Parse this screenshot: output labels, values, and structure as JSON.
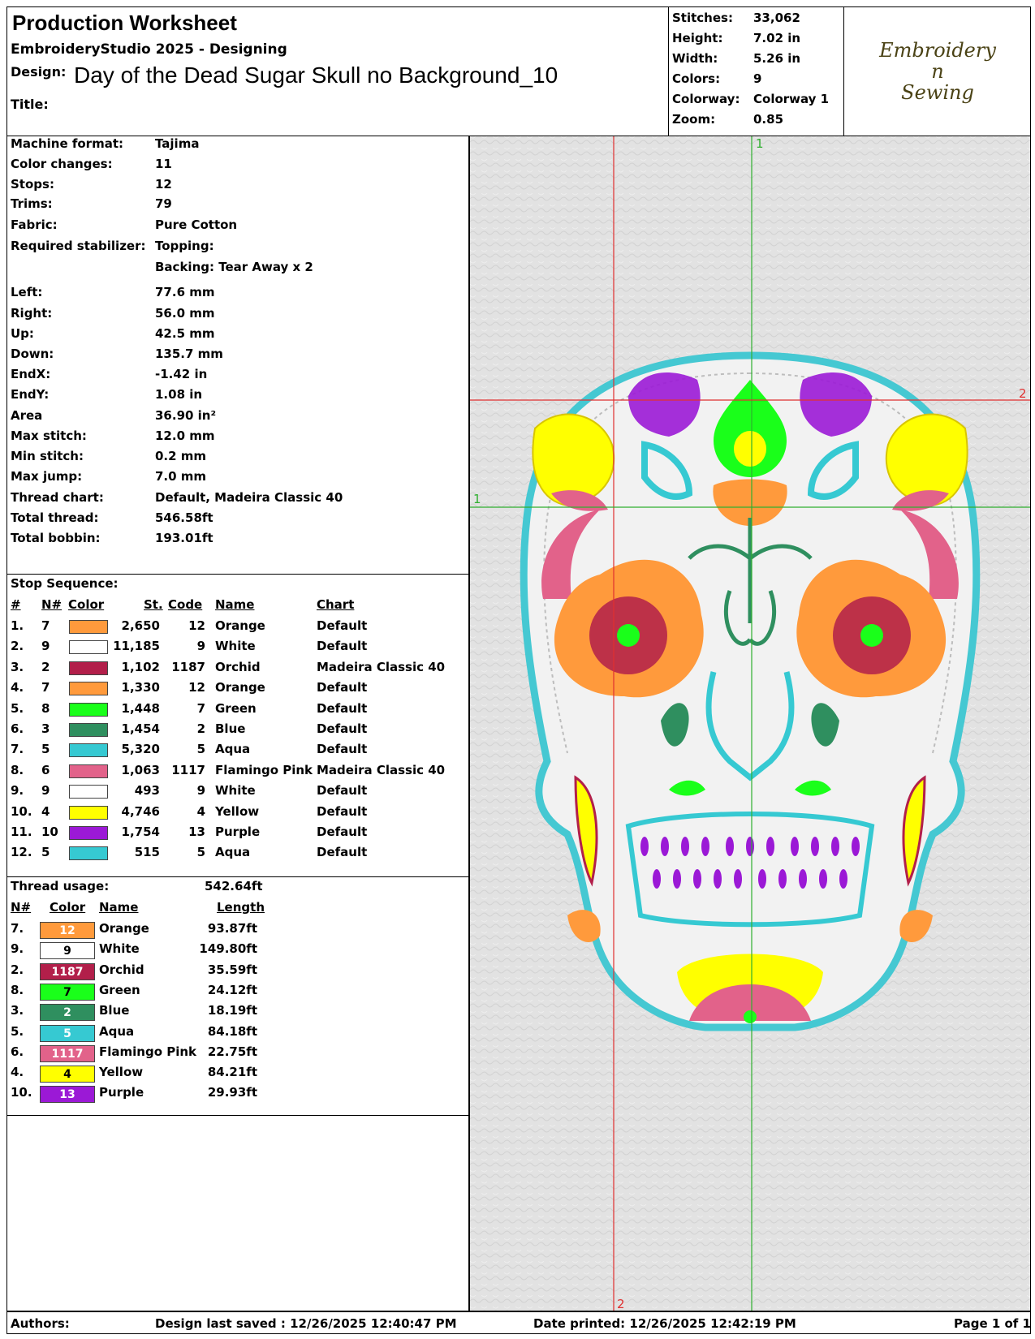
{
  "header": {
    "sheet_title": "Production Worksheet",
    "software": "EmbroideryStudio 2025 - Designing",
    "design_label": "Design:",
    "design_name": "Day of the Dead Sugar Skull no Background_10",
    "title_label": "Title:",
    "stats": [
      {
        "label": "Stitches:",
        "value": "33,062"
      },
      {
        "label": "Height:",
        "value": "7.02 in"
      },
      {
        "label": "Width:",
        "value": "5.26 in"
      },
      {
        "label": "Colors:",
        "value": "9"
      },
      {
        "label": "Colorway:",
        "value": "Colorway 1"
      },
      {
        "label": "Zoom:",
        "value": "0.85"
      }
    ],
    "logo_line1": "Embroidery",
    "logo_line2": "n",
    "logo_line3": "Sewing"
  },
  "info": [
    {
      "label": "Machine format:",
      "value": "Tajima"
    },
    {
      "label": "Color changes:",
      "value": "11"
    },
    {
      "label": "Stops:",
      "value": "12"
    },
    {
      "label": "Trims:",
      "value": "79"
    },
    {
      "label": "Fabric:",
      "value": "Pure Cotton"
    },
    {
      "label": "Required stabilizer:",
      "value": "Topping:"
    },
    {
      "label": "",
      "value": "Backing: Tear Away x 2"
    },
    {
      "label": "Left:",
      "value": "77.6 mm"
    },
    {
      "label": "Right:",
      "value": "56.0 mm"
    },
    {
      "label": "Up:",
      "value": "42.5 mm"
    },
    {
      "label": "Down:",
      "value": "135.7 mm"
    },
    {
      "label": "EndX:",
      "value": "-1.42 in"
    },
    {
      "label": "EndY:",
      "value": "1.08 in"
    },
    {
      "label": "Area",
      "value": " 36.90 in²"
    },
    {
      "label": "Max stitch:",
      "value": "12.0 mm"
    },
    {
      "label": "Min stitch:",
      "value": "0.2 mm"
    },
    {
      "label": "Max jump:",
      "value": "7.0 mm"
    },
    {
      "label": "Thread chart:",
      "value": "Default, Madeira Classic 40"
    },
    {
      "label": "Total thread:",
      "value": "546.58ft"
    },
    {
      "label": "Total bobbin:",
      "value": "193.01ft"
    }
  ],
  "stops": {
    "title": "Stop Sequence:",
    "headers": {
      "num": "#",
      "n": "N#",
      "color": "Color",
      "st": "St.",
      "code": "Code",
      "name": "Name",
      "chart": "Chart"
    },
    "rows": [
      {
        "num": "1.",
        "n": "7",
        "color": "#ff9a3c",
        "st": "2,650",
        "code": "12",
        "name": "Orange",
        "chart": "Default"
      },
      {
        "num": "2.",
        "n": "9",
        "color": "#ffffff",
        "st": "11,185",
        "code": "9",
        "name": "White",
        "chart": "Default"
      },
      {
        "num": "3.",
        "n": "2",
        "color": "#b21f4a",
        "st": "1,102",
        "code": "1187",
        "name": "Orchid",
        "chart": "Madeira Classic 40"
      },
      {
        "num": "4.",
        "n": "7",
        "color": "#ff9a3c",
        "st": "1,330",
        "code": "12",
        "name": "Orange",
        "chart": "Default"
      },
      {
        "num": "5.",
        "n": "8",
        "color": "#1aff1a",
        "st": "1,448",
        "code": "7",
        "name": "Green",
        "chart": "Default"
      },
      {
        "num": "6.",
        "n": "3",
        "color": "#2f8f5f",
        "st": "1,454",
        "code": "2",
        "name": "Blue",
        "chart": "Default"
      },
      {
        "num": "7.",
        "n": "5",
        "color": "#36c9d2",
        "st": "5,320",
        "code": "5",
        "name": "Aqua",
        "chart": "Default"
      },
      {
        "num": "8.",
        "n": "6",
        "color": "#e2628a",
        "st": "1,063",
        "code": "1117",
        "name": "Flamingo Pink",
        "chart": "Madeira Classic 40"
      },
      {
        "num": "9.",
        "n": "9",
        "color": "#ffffff",
        "st": "493",
        "code": "9",
        "name": "White",
        "chart": "Default"
      },
      {
        "num": "10.",
        "n": "4",
        "color": "#ffff00",
        "st": "4,746",
        "code": "4",
        "name": "Yellow",
        "chart": "Default"
      },
      {
        "num": "11.",
        "n": "10",
        "color": "#9b19d6",
        "st": "1,754",
        "code": "13",
        "name": "Purple",
        "chart": "Default"
      },
      {
        "num": "12.",
        "n": "5",
        "color": "#36c9d2",
        "st": "515",
        "code": "5",
        "name": "Aqua",
        "chart": "Default"
      }
    ]
  },
  "usage": {
    "title": "Thread usage:",
    "total": "542.64ft",
    "headers": {
      "n": "N#",
      "color": "Color",
      "name": "Name",
      "length": "Length"
    },
    "rows": [
      {
        "n": "7.",
        "color": "#ff9a3c",
        "code": "12",
        "name": "Orange",
        "length": "93.87ft"
      },
      {
        "n": "9.",
        "color": "#ffffff",
        "code": "9",
        "name": "White",
        "length": "149.80ft"
      },
      {
        "n": "2.",
        "color": "#b21f4a",
        "code": "1187",
        "name": "Orchid",
        "length": "35.59ft"
      },
      {
        "n": "8.",
        "color": "#1aff1a",
        "code": "7",
        "name": "Green",
        "length": "24.12ft"
      },
      {
        "n": "3.",
        "color": "#2f8f5f",
        "code": "2",
        "name": "Blue",
        "length": "18.19ft"
      },
      {
        "n": "5.",
        "color": "#36c9d2",
        "code": "5",
        "name": "Aqua",
        "length": "84.18ft"
      },
      {
        "n": "6.",
        "color": "#e2628a",
        "code": "1117",
        "name": "Flamingo Pink",
        "length": "22.75ft"
      },
      {
        "n": "4.",
        "color": "#ffff00",
        "code": "4",
        "name": "Yellow",
        "length": "84.21ft"
      },
      {
        "n": "10.",
        "color": "#9b19d6",
        "code": "13",
        "name": "Purple",
        "length": "29.93ft"
      }
    ]
  },
  "preview": {
    "guide_labels": [
      "1",
      "2",
      "1",
      "2"
    ]
  },
  "footer": {
    "authors": "Authors:",
    "saved": "Design last saved : 12/26/2025 12:40:47 PM",
    "printed": "Date printed: 12/26/2025 12:42:19 PM",
    "page": "Page 1 of 1"
  }
}
